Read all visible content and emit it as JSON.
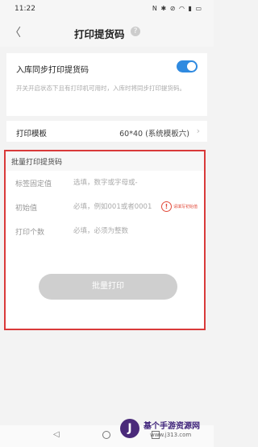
{
  "status_bar": {
    "time": "11:22",
    "icons": [
      "nfc-icon",
      "bluetooth-icon",
      "mute-icon",
      "wifi-icon",
      "signal-icon",
      "battery-icon"
    ]
  },
  "header": {
    "title": "打印提货码",
    "help_icon": "question-circle-icon",
    "back_icon": "chevron-left-icon"
  },
  "sync_section": {
    "label": "入库同步打印提货码",
    "toggle_on": true,
    "description": "开关开启状态下且有打印机可用时，入库时将同步打印提货码。"
  },
  "template_row": {
    "label": "打印模板",
    "value": "60*40 (系统模板六)"
  },
  "batch_section": {
    "header": "批量打印提货码",
    "fields": [
      {
        "label": "标签固定值",
        "placeholder": "选填，数字或字母或-"
      },
      {
        "label": "初始值",
        "placeholder": "必填，例如001或者0001",
        "warning": "请填写初始值"
      },
      {
        "label": "打印个数",
        "placeholder": "必填，必须为整数"
      }
    ],
    "button_label": "批量打印"
  },
  "watermark": {
    "logo_glyph": "J",
    "title": "基个手游资源网",
    "url": "www.j313.com"
  },
  "colors": {
    "accent": "#2f8ae0",
    "highlight_border": "#d93a3a",
    "warning": "#e24b3b",
    "button_disabled": "#cfcfcf"
  }
}
